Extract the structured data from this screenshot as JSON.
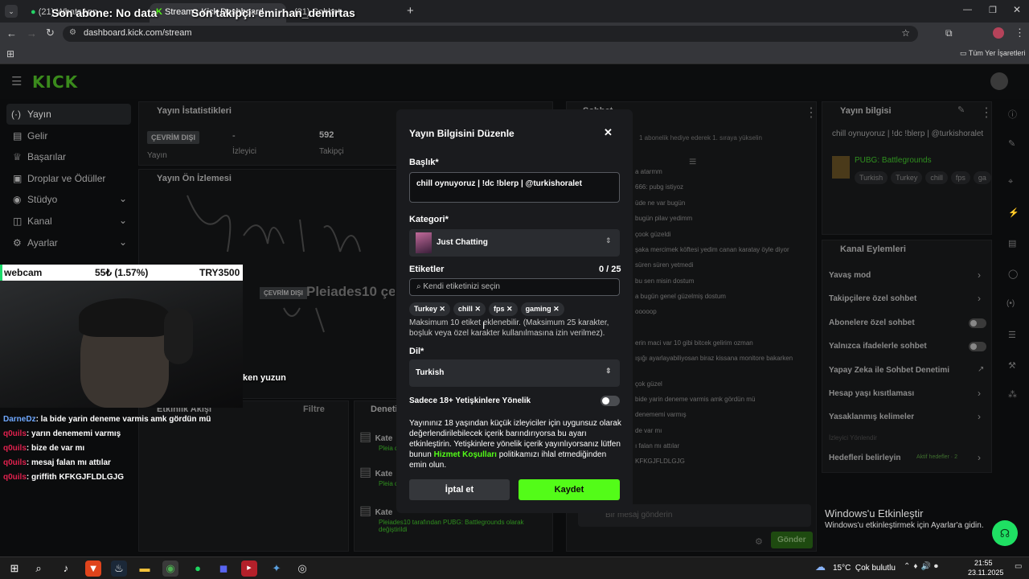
{
  "overlay": {
    "last_sub": "Son abone: No data",
    "last_follow": "Son takipçi: emirhan_demirtas"
  },
  "browser": {
    "tabs": [
      {
        "label": "(21) WhatsApp"
      },
      {
        "label": "Stream - Kick Dashboard"
      },
      {
        "label": "(21) Sohbet"
      }
    ],
    "url": "dashboard.kick.com/stream",
    "bookmarks_label": "Tüm Yer İşaretleri"
  },
  "kick": {
    "logo": "KICK",
    "nav": [
      {
        "label": "Yayın"
      },
      {
        "label": "Gelir"
      },
      {
        "label": "Başarılar"
      },
      {
        "label": "Droplar ve Ödüller"
      },
      {
        "label": "Stüdyo"
      },
      {
        "label": "Kanal"
      },
      {
        "label": "Ayarlar"
      }
    ],
    "stats": {
      "title": "Yayın İstatistikleri",
      "status": "ÇEVRİM DIŞI",
      "status_label": "Yayın",
      "viewers_value": "-",
      "viewers_label": "İzleyici",
      "followers_value": "592",
      "followers_label": "Takipçi"
    },
    "preview": {
      "title": "Yayın Ön İzlemesi",
      "offline_badge": "ÇEVRİM DIŞI",
      "channel": "Pleiades10 çev"
    },
    "activity": {
      "title": "Etkinlik Akışı",
      "filter": "Filtre"
    },
    "audit": {
      "title": "Denetim",
      "items": [
        {
          "title": "Kate",
          "detail": "Pleia değişti"
        },
        {
          "title": "Kate",
          "detail": "Pleia değişti"
        },
        {
          "title": "Kate",
          "detail": "Pleiades10 tarafından PUBG: Battlegrounds olarak değiştirildi"
        }
      ]
    },
    "chat": {
      "title": "Sohbet",
      "banner": "1 abonelik hediye ederek 1. sıraya yükselin",
      "lines": [
        "a atarmm",
        "666: pubg istiyoz",
        "üde ne var bugün",
        "bugün pilav yedimm",
        "çook güzeldi",
        "şaka mercimek köftesi yedim canan karatay öyle diyor",
        "süren süren yetmedi",
        "bu sen misin dostum",
        "a bugün genel güzelmiş dostum",
        "ooooop",
        "erin maci var 10 gibi bitcek gelirim ozman",
        "ışığı ayarlayabiliyosan biraz kissana monitore bakarken",
        "çok güzel",
        "bide yarin deneme varmis amk gördün mü",
        "denememi varmış",
        "de var mı",
        "ı falan mı attılar",
        "KFKGJFLDLGJG"
      ],
      "input_placeholder": "Bir mesaj gönderin",
      "send_label": "Gönder"
    },
    "info": {
      "title": "Yayın bilgisi",
      "stream_title": "chill oynuyoruz | !dc !blerp | @turkishoralet",
      "category": "PUBG: Battlegrounds",
      "tags": [
        "Turkish",
        "Turkey",
        "chill",
        "fps",
        "ga"
      ]
    },
    "actions": {
      "title": "Kanal Eylemleri",
      "items": [
        {
          "label": "Yavaş mod",
          "kind": "chevron"
        },
        {
          "label": "Takipçilere özel sohbet",
          "kind": "chevron"
        },
        {
          "label": "Abonelere özel sohbet",
          "kind": "toggle"
        },
        {
          "label": "Yalnızca ifadelerle sohbet",
          "kind": "toggle"
        },
        {
          "label": "Yapay Zeka ile Sohbet Denetimi",
          "kind": "link"
        },
        {
          "label": "Hesap yaşı kısıtlaması",
          "kind": "chevron"
        },
        {
          "label": "Yasaklanmış kelimeler",
          "kind": "chevron"
        },
        {
          "label": "İzleyici Yönlendir",
          "kind": "none"
        },
        {
          "label": "Hedefleri belirleyin",
          "kind": "chevron"
        }
      ],
      "goals_badge": "Aktif hedefler · 2"
    }
  },
  "webcam_overlay": {
    "label": "webcam",
    "price": "55₺ (1.57%)",
    "pair": "TRY3500",
    "caption": "ken yuzun"
  },
  "stream_chat": [
    {
      "user": "DarneDz",
      "msg": ": la bide yarin deneme varmis amk gördün mü",
      "color": "blue"
    },
    {
      "user": "q0uils",
      "msg": ": yarın denememi varmış",
      "color": "red"
    },
    {
      "user": "q0uils",
      "msg": ": bize de var mı",
      "color": "red"
    },
    {
      "user": "q0uils",
      "msg": ": mesaj falan mı attılar",
      "color": "red"
    },
    {
      "user": "q0uils",
      "msg": ": griffith KFKGJFLDLGJG",
      "color": "red"
    }
  ],
  "modal": {
    "title": "Yayın Bilgisini Düzenle",
    "title_label": "Başlık*",
    "title_value": "chill oynuyoruz | !dc !blerp | @turkishoralet",
    "category_label": "Kategori*",
    "category_value": "Just Chatting",
    "tags_label": "Etiketler",
    "tags_count": "0 / 25",
    "tags_placeholder": "Kendi etiketinizi seçin",
    "tags": [
      "Turkey",
      "chill",
      "fps",
      "gaming"
    ],
    "tags_help": "Maksimum 10 etiket eklenebilir. (Maksimum 25 karakter, boşluk veya özel karakter kullanılmasına izin verilmez).",
    "language_label": "Dil*",
    "language_value": "Turkish",
    "adult_label": "Sadece 18+ Yetişkinlere Yönelik",
    "adult_text_1": "Yayınınız 18 yaşından küçük izleyiciler için uygunsuz olarak değerlendirilebilecek içerik barındırıyorsa bu ayarı etkinleştirin. Yetişkinlere yönelik içerik yayınlıyorsanız lütfen bunun ",
    "adult_link": "Hizmet Koşulları",
    "adult_text_2": " politikamızı ihlal etmediğinden emin olun.",
    "cancel_label": "İptal et",
    "save_label": "Kaydet",
    "accent": "#53fc18"
  },
  "windows": {
    "activate_title": "Windows'u Etkinleştir",
    "activate_sub": "Windows'u etkinleştirmek için Ayarlar'a gidin.",
    "weather": "15°C  Çok bulutlu",
    "time": "21:55",
    "date": "23.11.2025"
  }
}
